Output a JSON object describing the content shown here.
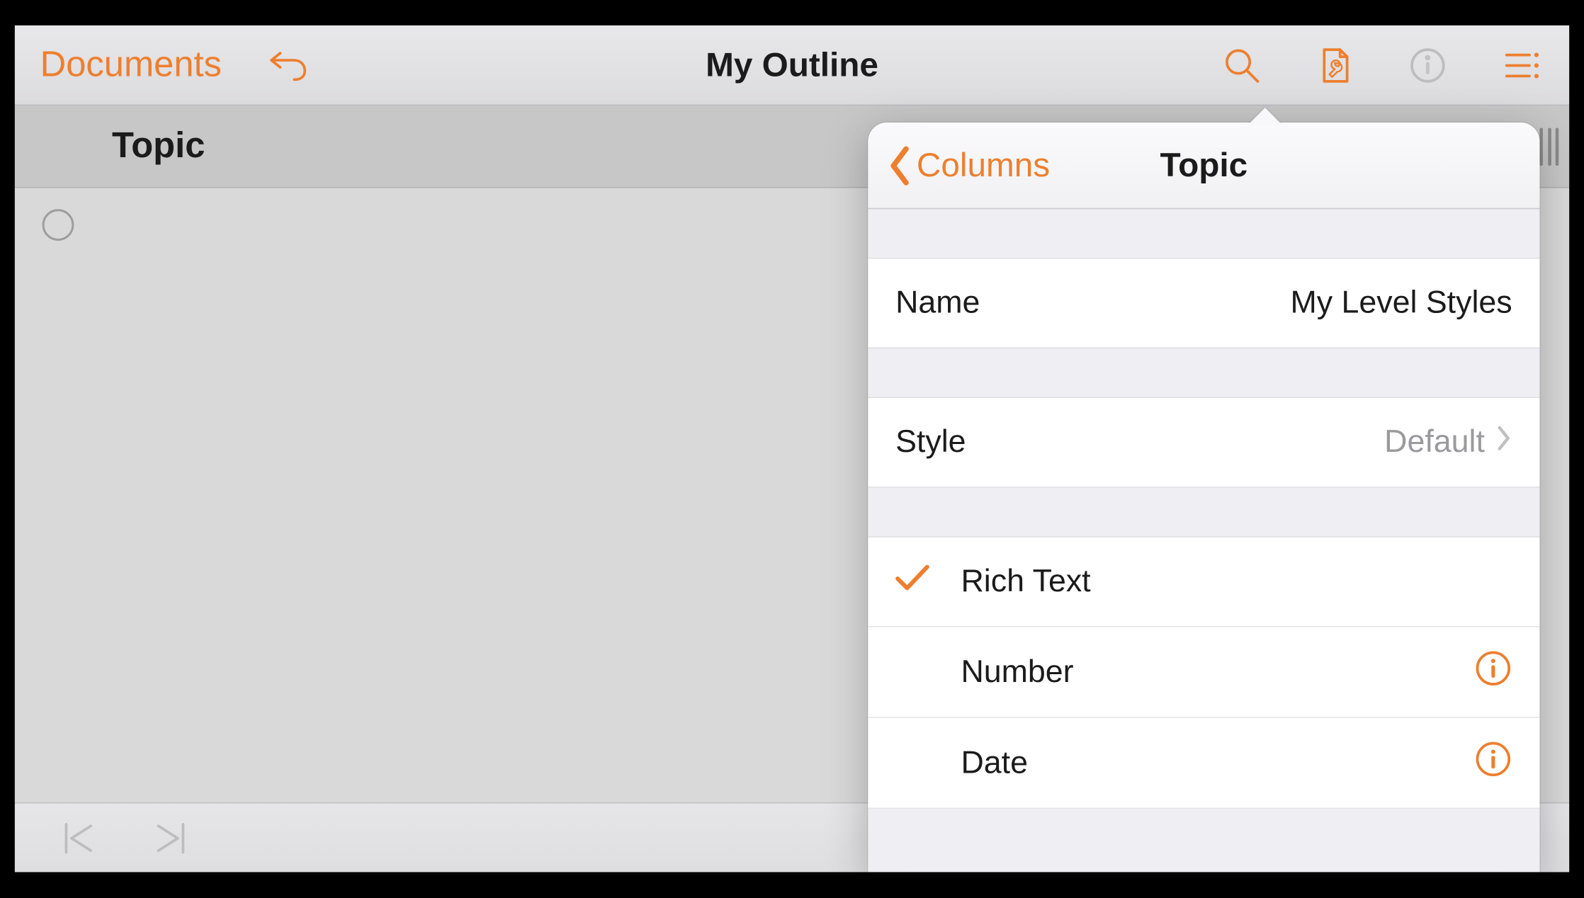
{
  "toolbar": {
    "documents_label": "Documents",
    "title": "My Outline"
  },
  "column_header": {
    "title": "Topic"
  },
  "popover": {
    "back_label": "Columns",
    "title": "Topic",
    "name_label": "Name",
    "name_value": "My Level Styles",
    "style_label": "Style",
    "style_value": "Default",
    "types": [
      {
        "label": "Rich Text",
        "selected": true,
        "has_info": false
      },
      {
        "label": "Number",
        "selected": false,
        "has_info": true
      },
      {
        "label": "Date",
        "selected": false,
        "has_info": true
      }
    ]
  },
  "colors": {
    "accent": "#ed7f2f"
  }
}
